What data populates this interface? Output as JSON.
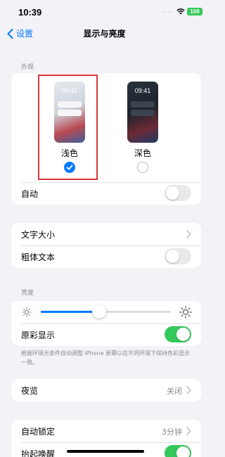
{
  "status_bar": {
    "time": "10:39",
    "signal": "....",
    "battery": "100"
  },
  "nav": {
    "back_label": "设置",
    "title": "显示与亮度"
  },
  "appearance": {
    "section_label": "外观",
    "light": {
      "preview_time": "09:41",
      "label": "浅色",
      "selected": true
    },
    "dark": {
      "preview_time": "09:41",
      "label": "深色",
      "selected": false
    },
    "auto_label": "自动",
    "auto_on": false
  },
  "text": {
    "text_size_label": "文字大小",
    "bold_text_label": "粗体文本",
    "bold_text_on": false
  },
  "brightness": {
    "section_label": "亮度",
    "level": 0.45,
    "true_tone_label": "原彩显示",
    "true_tone_on": true,
    "footnote": "根据环境光条件自动调整 iPhone 屏幕以在不同环境下保持色彩显示一致。"
  },
  "night_shift": {
    "label": "夜览",
    "value": "关闭"
  },
  "lock": {
    "auto_lock_label": "自动锁定",
    "auto_lock_value": "3分钟",
    "raise_to_wake_label": "抬起唤醒",
    "raise_to_wake_on": true
  },
  "colors": {
    "accent": "#007aff",
    "toggle_on": "#34c759",
    "highlight": "#d9363e"
  }
}
